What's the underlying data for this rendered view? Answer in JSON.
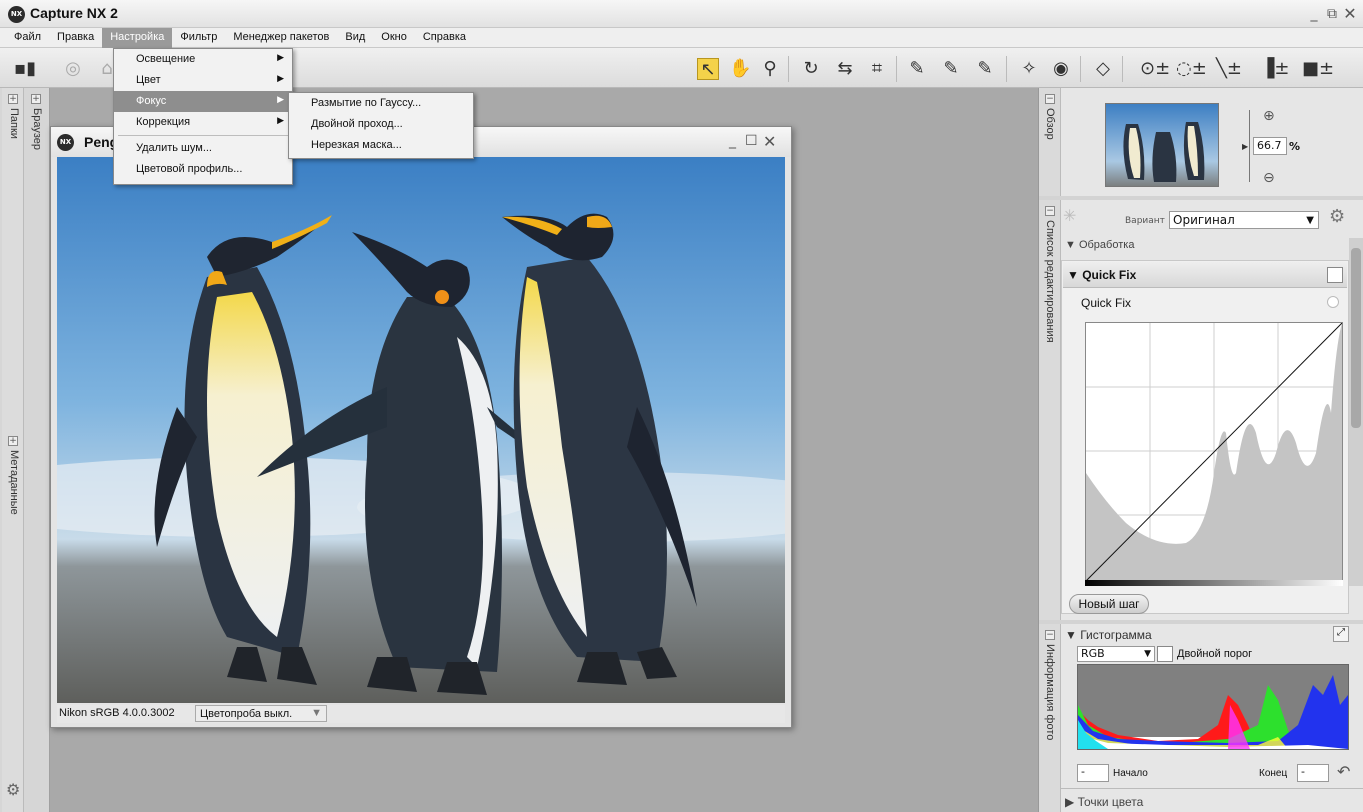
{
  "app": {
    "title": "Capture NX 2",
    "logo_text": "NX"
  },
  "menubar": [
    "Файл",
    "Правка",
    "Настройка",
    "Фильтр",
    "Менеджер пакетов",
    "Вид",
    "Окно",
    "Справка"
  ],
  "menu_active": "Настройка",
  "settings_menu": {
    "items": [
      {
        "label": "Освещение",
        "submenu": true
      },
      {
        "label": "Цвет",
        "submenu": true
      },
      {
        "label": "Фокус",
        "submenu": true,
        "highlighted": true
      },
      {
        "label": "Коррекция",
        "submenu": true
      },
      {
        "label": "Удалить шум...",
        "submenu": false
      },
      {
        "label": "Цветовой профиль...",
        "submenu": false
      }
    ]
  },
  "focus_submenu": [
    "Размытие по Гауссу...",
    "Двойной проход...",
    "Нерезкая маска..."
  ],
  "left_rail": {
    "folders": "Папки",
    "browser": "Браузер",
    "metadata": "Метаданные"
  },
  "document": {
    "title": "Peng",
    "profile": "Nikon sRGB 4.0.0.3002",
    "softproof": "Цветопроба выкл."
  },
  "overview": {
    "label": "Обзор",
    "zoom_value": "66.7",
    "zoom_unit": "%"
  },
  "edit_list": {
    "label": "Список редактирования",
    "variant_label": "Вариант",
    "variant_value": "Оригинал",
    "processing_label": "Обработка",
    "quick_fix_header": "Quick Fix",
    "quick_fix_row": "Quick Fix",
    "new_step": "Новый шаг"
  },
  "photo_info": {
    "label": "Информация фото",
    "histogram_title": "Гистограмма",
    "channel": "RGB",
    "double_threshold": "Двойной порог",
    "start_label": "Начало",
    "start_value": "-",
    "end_label": "Конец",
    "end_value": "-",
    "color_points": "Точки цвета"
  },
  "colors": {
    "accent_tool": "#f4d24a",
    "menu_highlight": "#8e8e8e",
    "hist_red": "#ff0000",
    "hist_green": "#33dd33",
    "hist_blue": "#2233ee"
  }
}
